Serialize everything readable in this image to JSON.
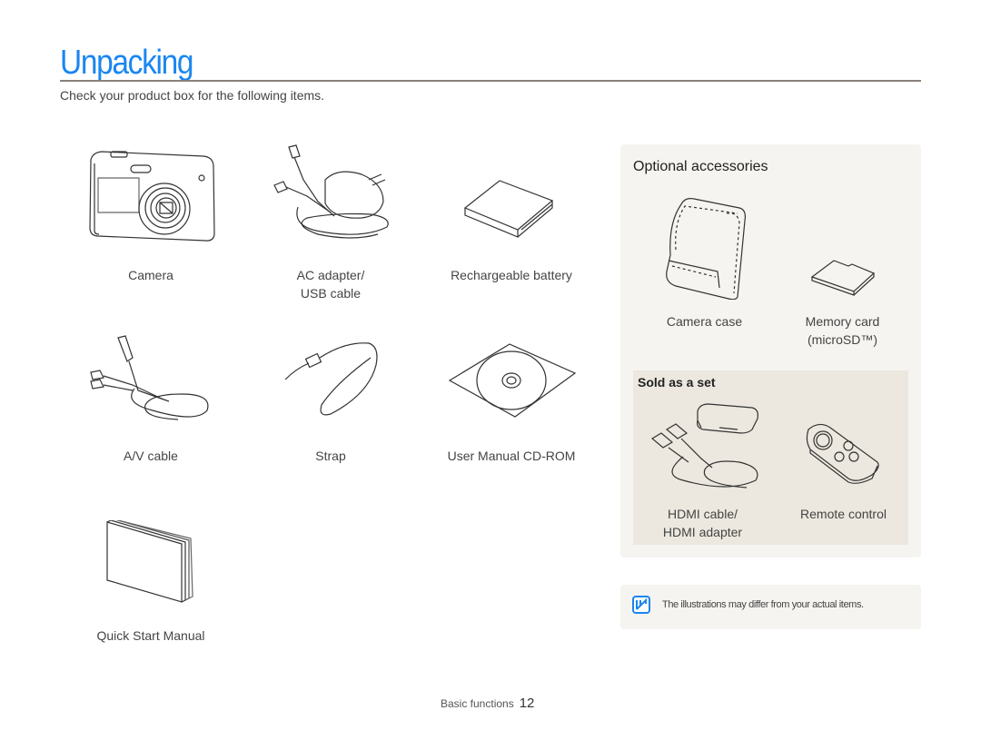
{
  "page": {
    "title": "Unpacking",
    "subtitle": "Check your product box for the following items."
  },
  "box_items": [
    {
      "icon": "camera-icon",
      "label": "Camera"
    },
    {
      "icon": "ac-adapter-icon",
      "label": "AC adapter/",
      "label2": "USB cable"
    },
    {
      "icon": "battery-icon",
      "label": "Rechargeable battery"
    },
    {
      "icon": "av-cable-icon",
      "label": "A/V cable"
    },
    {
      "icon": "strap-icon",
      "label": "Strap"
    },
    {
      "icon": "cd-rom-icon",
      "label": "User Manual CD-ROM"
    },
    {
      "icon": "manual-icon",
      "label": "Quick Start Manual"
    }
  ],
  "optional": {
    "title": "Optional accessories",
    "items": [
      {
        "icon": "camera-case-icon",
        "label": "Camera case"
      },
      {
        "icon": "memory-card-icon",
        "label": "Memory card",
        "label2": "(microSD™)"
      }
    ],
    "set": {
      "title": "Sold as a set",
      "items": [
        {
          "icon": "hdmi-cable-icon",
          "label": "HDMI cable/",
          "label2": "HDMI adapter"
        },
        {
          "icon": "remote-control-icon",
          "label": "Remote control"
        }
      ]
    }
  },
  "note": {
    "icon": "note-icon",
    "text": "The illustrations may differ from your actual items.",
    "accent": "#1a86f0"
  },
  "footer": {
    "section": "Basic functions",
    "page_number": "12"
  },
  "colors": {
    "title": "#1a86f0",
    "panel": "#f6f4f0",
    "set_panel": "#ece8df"
  }
}
